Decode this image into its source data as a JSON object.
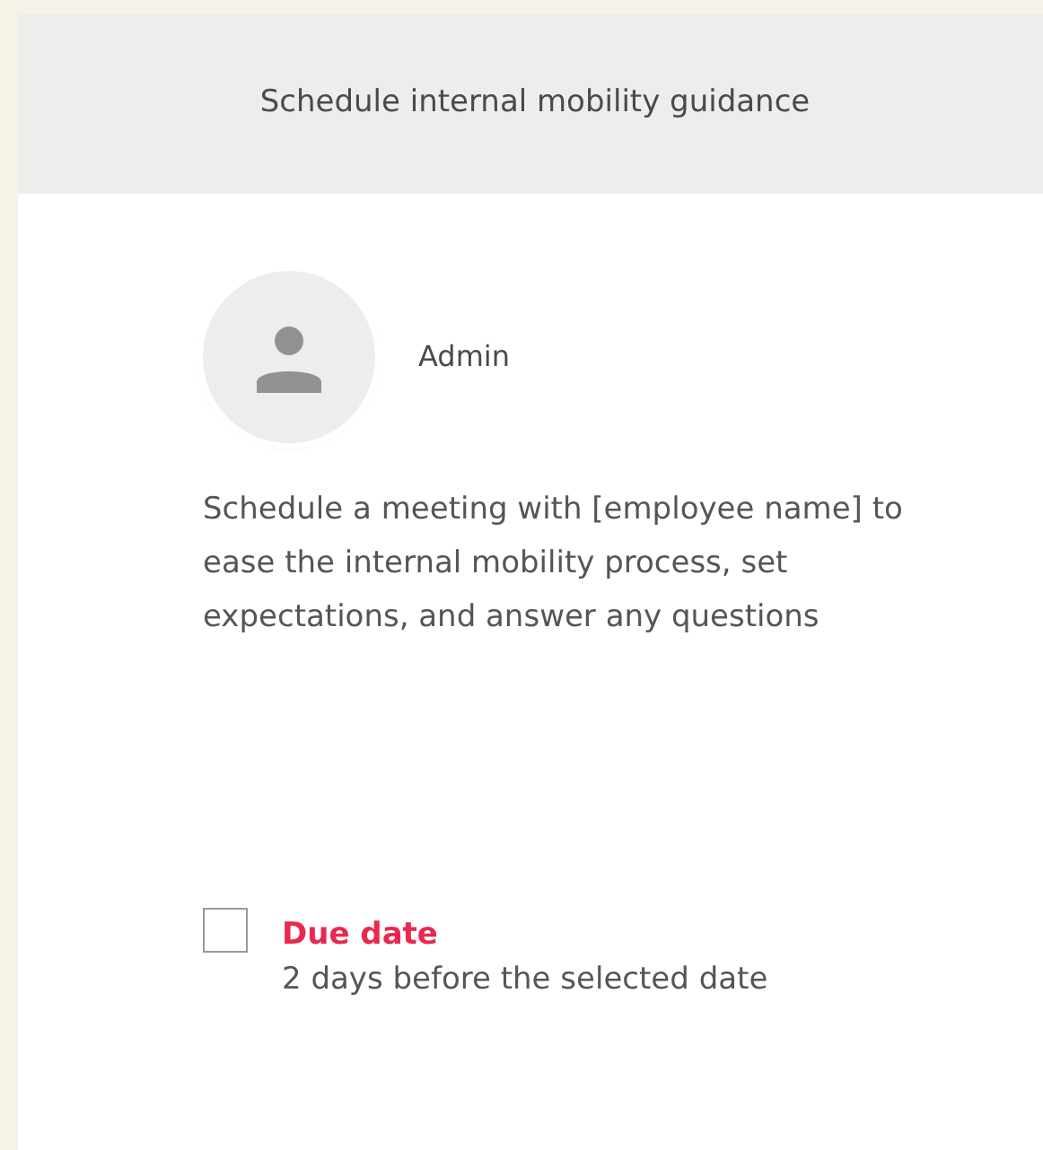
{
  "header": {
    "title": "Schedule internal mobility guidance"
  },
  "assignee": {
    "name": "Admin"
  },
  "description": "Schedule a meeting with [employee name] to ease the internal mobility process, set expectations, and answer any questions",
  "due": {
    "label": "Due date",
    "checked": false,
    "detail": "2 days before the selected date"
  }
}
